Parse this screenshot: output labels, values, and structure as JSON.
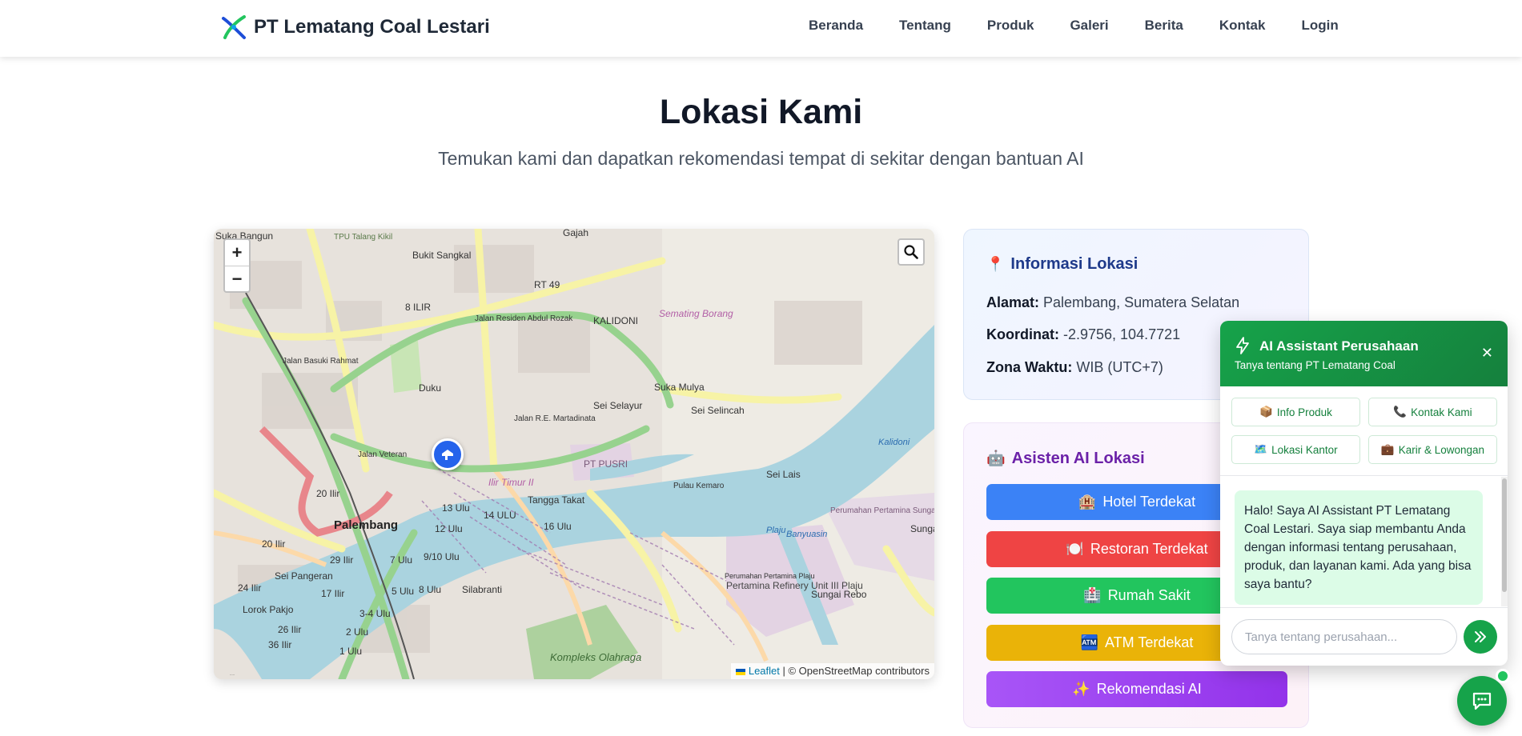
{
  "navbar": {
    "brand": "PT Lematang Coal Lestari",
    "links": [
      "Beranda",
      "Tentang",
      "Produk",
      "Galeri",
      "Berita",
      "Kontak",
      "Login"
    ]
  },
  "hero": {
    "title": "Lokasi Kami",
    "subtitle": "Temukan kami dan dapatkan rekomendasi tempat di sekitar dengan bantuan AI"
  },
  "map": {
    "zoom_in": "+",
    "zoom_out": "−",
    "attribution_leaflet": "Leaflet",
    "attribution_rest": " | © OpenStreetMap contributors",
    "labels": [
      "Suka Bangun",
      "TPU Talang Kikil",
      "Gajah",
      "Bukit Sangkal",
      "RT 49",
      "8 ILIR",
      "KALIDONI",
      "Semating Borang",
      "Jalan Basuki Rahmat",
      "Jalan Residen Abdul Rozak",
      "Duku",
      "Jalan R.E. Martadinata",
      "Suka Mulya",
      "Sei Selayur",
      "Sei Selincah",
      "PT PUSRI",
      "Pulau Kemaro",
      "Sei Lais",
      "Kalidoni",
      "Jalan Veteran",
      "Ilir Timur II",
      "20 Ilir",
      "13 Ulu",
      "14 ULU",
      "Tangga Takat",
      "Palembang",
      "12 Ulu",
      "16 Ulu",
      "20 Ilir",
      "9/10 Ulu",
      "29 Ilir",
      "7 Ulu",
      "Sei Pangeran",
      "17 Ilir",
      "5 Ulu",
      "8 Ulu",
      "Silabranti",
      "24 Ilir",
      "Lorok Pakjo",
      "3-4 Ulu",
      "26 Ilir",
      "36 Ilir",
      "2 Ulu",
      "1 Ulu",
      "Kompleks Olahraga",
      "Pertamina Refinery Unit III Plaju",
      "Perumahan Pertamina Plaju",
      "Perumahan Pertamina Sungai Gerong",
      "Sungai Gerong",
      "Sungai Rebo",
      "Plaju",
      "Banyuasin"
    ]
  },
  "info": {
    "title": "Informasi Lokasi",
    "address_label": "Alamat:",
    "address": "Palembang, Sumatera Selatan",
    "coord_label": "Koordinat:",
    "coord": "-2.9756, 104.7721",
    "tz_label": "Zona Waktu:",
    "tz": "WIB (UTC+7)"
  },
  "ai_local": {
    "title": "Asisten AI Lokasi",
    "buttons": [
      {
        "icon": "🏨",
        "label": "Hotel Terdekat",
        "color": "#3b82f6"
      },
      {
        "icon": "🍽️",
        "label": "Restoran Terdekat",
        "color": "#ef4444"
      },
      {
        "icon": "🏥",
        "label": "Rumah Sakit",
        "color": "#22c55e"
      },
      {
        "icon": "🏧",
        "label": "ATM Terdekat",
        "color": "#eab308"
      },
      {
        "icon": "✨",
        "label": "Rekomendasi AI",
        "color": "#a855f7"
      }
    ]
  },
  "chat": {
    "title": "AI Assistant Perusahaan",
    "subtitle": "Tanya tentang PT Lematang Coal",
    "close": "✕",
    "quick": [
      {
        "icon": "📦",
        "label": "Info Produk"
      },
      {
        "icon": "📞",
        "label": "Kontak Kami"
      },
      {
        "icon": "🗺️",
        "label": "Lokasi Kantor"
      },
      {
        "icon": "💼",
        "label": "Karir & Lowongan"
      }
    ],
    "message": "Halo! Saya AI Assistant PT Lematang Coal Lestari. Saya siap membantu Anda dengan informasi tentang perusahaan, produk, dan layanan kami. Ada yang bisa saya bantu?",
    "placeholder": "Tanya tentang perusahaan..."
  },
  "colors": {
    "primary_green": "#16a34a",
    "info_title": "#1e3a8a",
    "ai_title": "#6b21a8",
    "accent_blue": "#2563eb"
  }
}
